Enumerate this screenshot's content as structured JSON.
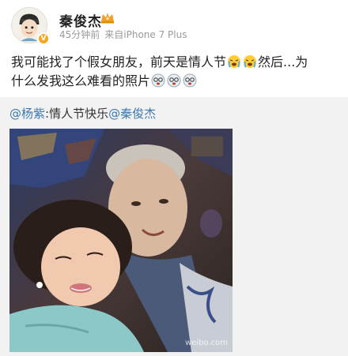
{
  "post": {
    "username": "秦俊杰",
    "time": "45分钟前",
    "source": "来自iPhone 7 Plus",
    "text_line1": "我可能找了个假女朋友，前天是情人节",
    "text_line1_after": "然后...为",
    "text_line2": "什么发我这么难看的照片",
    "verified_icon": "verified-badge",
    "crown_icon": "crown-icon"
  },
  "repost": {
    "mention1": "@杨紫",
    "text_mid": ":情人节快乐",
    "mention2": "@秦俊杰"
  },
  "colors": {
    "mention": "#3b78b4",
    "meta": "#9a9a9a",
    "repost_bg": "#f2f2f2"
  }
}
